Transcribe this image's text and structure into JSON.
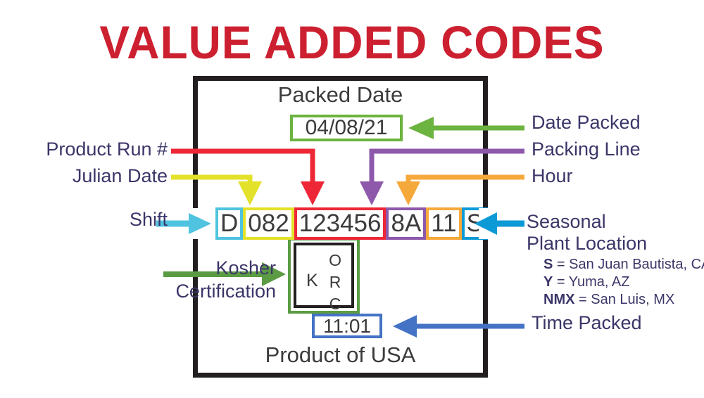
{
  "title": "VALUE ADDED CODES",
  "package": {
    "packed_date_label": "Packed Date",
    "packed_date_value": "04/08/21",
    "time_value": "11:01",
    "product_of": "Product of USA",
    "kosher": {
      "letter_k": "K",
      "letter_o": "O",
      "letter_r": "R",
      "letter_c": "C"
    }
  },
  "code": {
    "segments": [
      {
        "id": "shift",
        "value": "D",
        "color": "#4fc3e0",
        "label": "Shift"
      },
      {
        "id": "julian",
        "value": "082",
        "color": "#e4e12a",
        "label": "Julian Date"
      },
      {
        "id": "run",
        "value": "123456",
        "color": "#ee2737",
        "label": "Product Run #"
      },
      {
        "id": "line",
        "value": "8A",
        "color": "#8e58ab",
        "label": "Packing Line"
      },
      {
        "id": "hour",
        "value": "11",
        "color": "#f6a93b",
        "label": "Hour"
      },
      {
        "id": "plant",
        "value": "S",
        "color": "#0c9ad7",
        "label": "Seasonal Plant Location"
      }
    ],
    "full_code": "D 082 123456 8A 11 S"
  },
  "labels_left": {
    "product_run": "Product Run #",
    "julian_date": "Julian Date",
    "shift": "Shift",
    "kosher_line1": "Kosher",
    "kosher_line2": "Certification"
  },
  "labels_right": {
    "date_packed": "Date Packed",
    "packing_line": "Packing Line",
    "hour": "Hour",
    "time_packed": "Time Packed",
    "seasonal_line1": "Seasonal",
    "seasonal_line2": "Plant Location"
  },
  "plant_codes": [
    {
      "code": "S",
      "sep": " = ",
      "place": "San Juan Bautista, CA"
    },
    {
      "code": "Y",
      "sep": " = ",
      "place": "Yuma, AZ"
    },
    {
      "code": "NMX",
      "sep": " = ",
      "place": "San Luis, MX"
    }
  ],
  "colors": {
    "title_red": "#cc2030",
    "label_navy": "#3b3668",
    "frame_dark": "#231f20",
    "value_gray": "#3b3b3b",
    "date_green": "#6cb33f",
    "kosher_green": "#5b9b43",
    "time_blue": "#4472c4",
    "shift_cyan": "#4fc3e0",
    "julian_yellow": "#e4e12a",
    "run_red": "#ee2737",
    "line_purple": "#8e58ab",
    "hour_orange": "#f6a93b",
    "plant_blue": "#0c9ad7"
  }
}
